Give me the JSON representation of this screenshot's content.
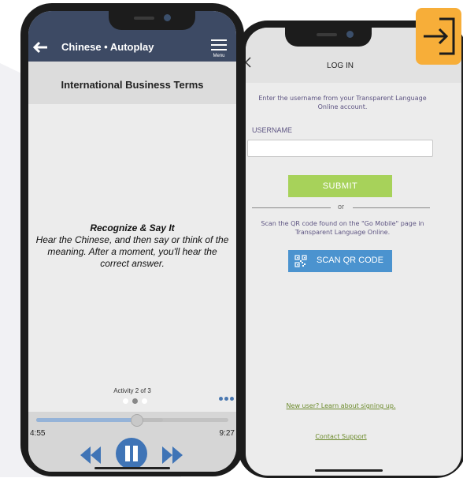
{
  "left_phone": {
    "header": {
      "title": "Chinese • Autoplay",
      "menu_label": "Menu"
    },
    "lesson_title": "International Business Terms",
    "instructions": {
      "title": "Recognize & Say It",
      "body": "Hear the Chinese, and then say or think of the meaning. After a moment, you'll hear the correct answer."
    },
    "activity_label": "Activity 2 of 3",
    "activity_dots": {
      "total": 3,
      "current": 2
    },
    "player": {
      "time_elapsed": "4:55",
      "time_total": "9:27",
      "progress": 0.52,
      "buffered": 0.66
    },
    "icons": [
      "back-arrow-icon",
      "menu-icon",
      "more-dots-icon",
      "rewind-icon",
      "pause-icon",
      "fast-forward-icon"
    ]
  },
  "right_phone": {
    "title": "LOG IN",
    "enter_text": "Enter the username from your Transparent Language Online account.",
    "username_label": "USERNAME",
    "username_value": "",
    "submit_label": "SUBMIT",
    "or_label": "or",
    "scan_text": "Scan the QR code found on the \"Go Mobile\" page in Transparent Language Online.",
    "scan_button_label": "SCAN QR CODE",
    "new_user_link": "New user? Learn about signing up.",
    "contact_link": "Contact Support"
  },
  "colors": {
    "header_bg": "#3d4a64",
    "submit_green": "#a7d25a",
    "scan_blue": "#4b93cf",
    "link_green": "#6b8a2a",
    "text_purple": "#5d5482",
    "badge_orange": "#f7ae39"
  }
}
